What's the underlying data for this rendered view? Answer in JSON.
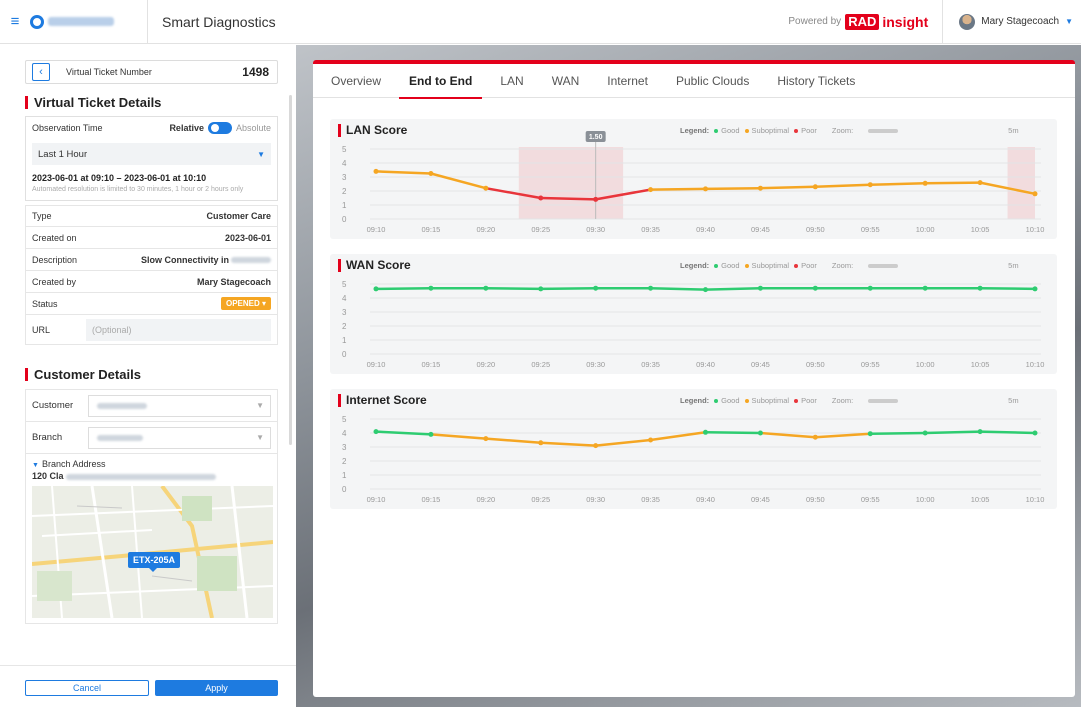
{
  "header": {
    "app_title": "Smart Diagnostics",
    "powered_by": "Powered by",
    "brand_rad": "RAD",
    "brand_insight": "insight",
    "user_name": "Mary Stagecoach"
  },
  "ticket": {
    "label": "Virtual Ticket Number",
    "number": "1498",
    "section_title": "Virtual Ticket Details",
    "observation_label": "Observation Time",
    "relative": "Relative",
    "absolute": "Absolute",
    "period": "Last 1 Hour",
    "range": "2023-06-01 at 09:10 – 2023-06-01 at 10:10",
    "note": "Automated resolution is limited to 30 minutes, 1 hour or 2 hours only",
    "fields": [
      {
        "key": "Type",
        "value": "Customer Care"
      },
      {
        "key": "Created on",
        "value": "2023-06-01"
      },
      {
        "key": "Description",
        "value": "Slow Connectivity in"
      },
      {
        "key": "Created by",
        "value": "Mary Stagecoach"
      }
    ],
    "status_label": "Status",
    "status_value": "OPENED ▾",
    "url_label": "URL",
    "url_placeholder": "(Optional)"
  },
  "customer": {
    "section_title": "Customer Details",
    "customer_label": "Customer",
    "branch_label": "Branch",
    "address_title": "Branch Address",
    "address_value": "120 Cla",
    "map_label": "ETX-205A"
  },
  "footer": {
    "cancel": "Cancel",
    "apply": "Apply"
  },
  "tabs": [
    "Overview",
    "End to End",
    "LAN",
    "WAN",
    "Internet",
    "Public Clouds",
    "History Tickets"
  ],
  "active_tab": "End to End",
  "legend": {
    "label": "Legend:",
    "good": "Good",
    "suboptimal": "Suboptimal",
    "poor": "Poor",
    "zoom": "Zoom:",
    "zoom_value": "5m"
  },
  "colors": {
    "good": "#2ecc71",
    "suboptimal": "#f5a623",
    "poor": "#e8353b",
    "accent": "#e3001b",
    "primary": "#1e7be0"
  },
  "chart_data": [
    {
      "type": "line",
      "title": "LAN Score",
      "x": [
        "09:10",
        "09:15",
        "09:20",
        "09:25",
        "09:30",
        "09:35",
        "09:40",
        "09:45",
        "09:50",
        "09:55",
        "10:00",
        "10:05",
        "10:10"
      ],
      "values": [
        3.4,
        3.25,
        2.2,
        1.5,
        1.4,
        2.1,
        2.15,
        2.2,
        2.3,
        2.45,
        2.55,
        2.6,
        1.8
      ],
      "ylim": [
        0,
        5
      ],
      "yticks": [
        0,
        1,
        2,
        3,
        4,
        5
      ],
      "tooltip": {
        "x": "09:30",
        "value": "1.50"
      }
    },
    {
      "type": "line",
      "title": "WAN Score",
      "x": [
        "09:10",
        "09:15",
        "09:20",
        "09:25",
        "09:30",
        "09:35",
        "09:40",
        "09:45",
        "09:50",
        "09:55",
        "10:00",
        "10:05",
        "10:10"
      ],
      "values": [
        4.65,
        4.7,
        4.7,
        4.65,
        4.7,
        4.7,
        4.6,
        4.7,
        4.7,
        4.7,
        4.7,
        4.7,
        4.65
      ],
      "ylim": [
        0,
        5
      ],
      "yticks": [
        0,
        1,
        2,
        3,
        4,
        5
      ]
    },
    {
      "type": "line",
      "title": "Internet Score",
      "x": [
        "09:10",
        "09:15",
        "09:20",
        "09:25",
        "09:30",
        "09:35",
        "09:40",
        "09:45",
        "09:50",
        "09:55",
        "10:00",
        "10:05",
        "10:10"
      ],
      "values": [
        4.1,
        3.9,
        3.6,
        3.3,
        3.1,
        3.5,
        4.05,
        4.0,
        3.7,
        3.95,
        4.0,
        4.1,
        4.0
      ],
      "ylim": [
        0,
        5
      ],
      "yticks": [
        0,
        1,
        2,
        3,
        4,
        5
      ]
    }
  ]
}
